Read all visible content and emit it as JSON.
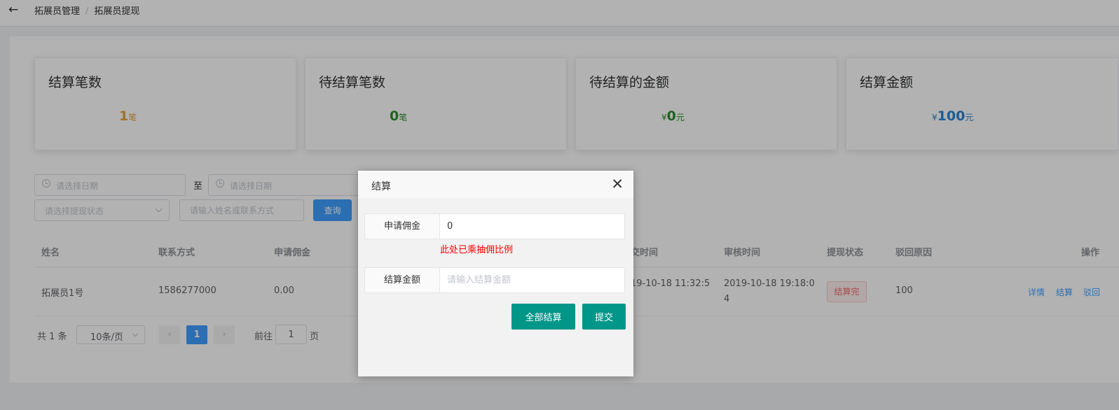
{
  "nav": {
    "back_icon": "arrow-left-icon",
    "breadcrumb": [
      "拓展员管理",
      "拓展员提现"
    ],
    "breadcrumb_sep": "/"
  },
  "stats": [
    {
      "title": "结算笔数",
      "value": "1",
      "unit": "笔",
      "currency": "",
      "color": "#e6a23c"
    },
    {
      "title": "待结算笔数",
      "value": "0",
      "unit": "笔",
      "currency": "",
      "color": "#2e8b2e"
    },
    {
      "title": "待结算的金额",
      "value": "0",
      "unit": "元",
      "currency": "¥",
      "color": "#2e8b2e"
    },
    {
      "title": "结算金额",
      "value": "100",
      "unit": "元",
      "currency": "¥",
      "color": "#2b85d6"
    }
  ],
  "filters": {
    "start_date_placeholder": "请选择日期",
    "to_label": "至",
    "end_date_placeholder": "请选择日期",
    "status_placeholder": "请选择提现状态",
    "search_placeholder": "请输入姓名或联系方式",
    "query_label": "查询"
  },
  "table": {
    "headers": [
      "姓名",
      "联系方式",
      "申请佣金",
      "交时间",
      "审核时间",
      "提现状态",
      "驳回原因",
      "操作"
    ],
    "row": {
      "name": "拓展员1号",
      "contact": "1586277000",
      "commission": "0.00",
      "submit_time": "19-10-18 11:32:5",
      "review_time_1": "2019-10-18 19:18:0",
      "review_time_2": "4",
      "status": "结算完",
      "reject_reason": "100",
      "actions": [
        "详情",
        "结算",
        "驳回"
      ]
    }
  },
  "pagination": {
    "total": "共 1 条",
    "page_size": "10条/页",
    "prev": "‹",
    "current": "1",
    "next": "›",
    "goto_label": "前往",
    "goto_value": "1",
    "page_suffix": "页"
  },
  "dialog": {
    "title": "结算",
    "close_icon": "close-icon",
    "commission_label": "申请佣金",
    "commission_value": "0",
    "hint": "此处已乘抽佣比例",
    "amount_label": "结算金额",
    "amount_placeholder": "请输入结算金额",
    "settle_all_label": "全部结算",
    "submit_label": "提交"
  }
}
